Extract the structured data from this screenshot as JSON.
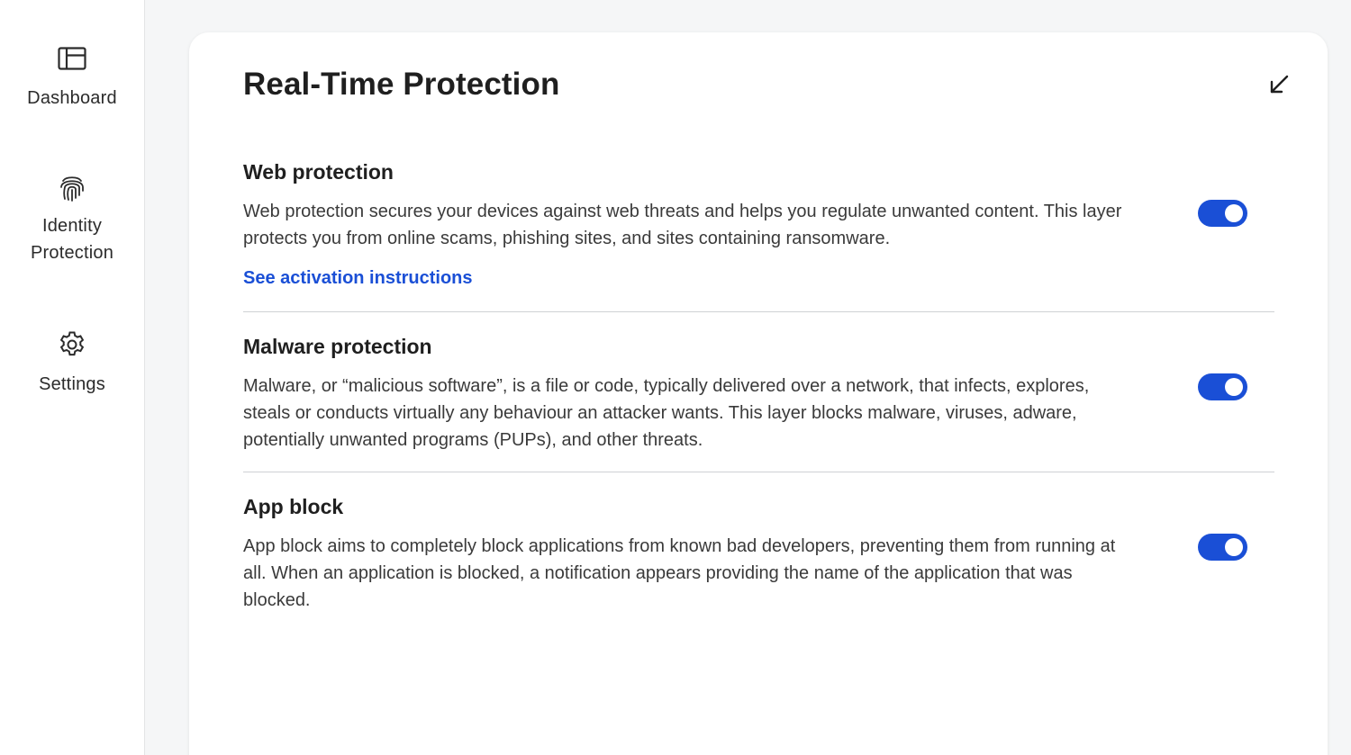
{
  "sidebar": {
    "items": [
      {
        "label": "Dashboard",
        "icon": "dashboard-icon"
      },
      {
        "label": "Identity Protection",
        "icon": "fingerprint-icon"
      },
      {
        "label": "Settings",
        "icon": "gear-icon"
      }
    ]
  },
  "panel": {
    "title": "Real-Time Protection",
    "collapse_icon": "arrow-down-left-icon",
    "sections": [
      {
        "title": "Web protection",
        "description": "Web protection secures your devices against web threats and helps you regulate unwanted content. This layer protects you from online scams, phishing sites, and sites containing ransomware.",
        "link": "See activation instructions",
        "enabled": true
      },
      {
        "title": "Malware protection",
        "description": "Malware, or “malicious software”, is a file or code, typically delivered over a network, that infects, explores, steals or conducts virtually any behaviour an attacker wants. This layer blocks malware, viruses, adware, potentially unwanted programs (PUPs), and other threats.",
        "enabled": true
      },
      {
        "title": "App block",
        "description": "App block aims to completely block applications from known bad developers, preventing them from running at all. When an application is blocked, a notification appears providing the name of the application that was blocked.",
        "enabled": true
      }
    ]
  },
  "colors": {
    "accent": "#1a4fd6",
    "toggle_on": "#1a4fd6",
    "background": "#f5f6f7",
    "panel": "#ffffff"
  }
}
